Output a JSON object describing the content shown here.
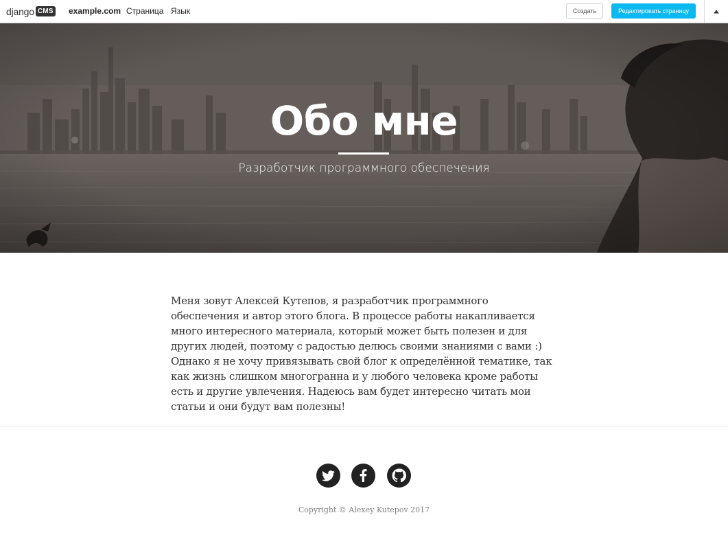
{
  "toolbar": {
    "logo_word": "django",
    "logo_badge": "CMS",
    "site": "example.com",
    "menu": [
      "Страница",
      "Язык"
    ],
    "create_label": "Создать",
    "edit_label": "Редактировать страницу",
    "accent_color": "#0bb9f0"
  },
  "hero": {
    "title": "Обо мне",
    "subtitle": "Разработчик программного обеспечения"
  },
  "content": {
    "paragraph": "Меня зовут Алексей Кутепов, я разработчик программного обеспечения и автор этого блога. В процессе работы накапливается много интересного материала, который может быть полезен и для других людей, поэтому с радостью делюсь своими знаниями с вами :) Однако я не хочу привязывать свой блог к определённой тематике, так как жизнь слишком многогранна и у любого человека кроме работы есть и другие увлечения. Надеюсь вам будет интересно читать мои статьи и они будут вам полезны!"
  },
  "footer": {
    "social_icons": [
      "twitter-icon",
      "facebook-icon",
      "github-icon"
    ],
    "copyright": "Copyright © Alexey Kutepov 2017"
  }
}
